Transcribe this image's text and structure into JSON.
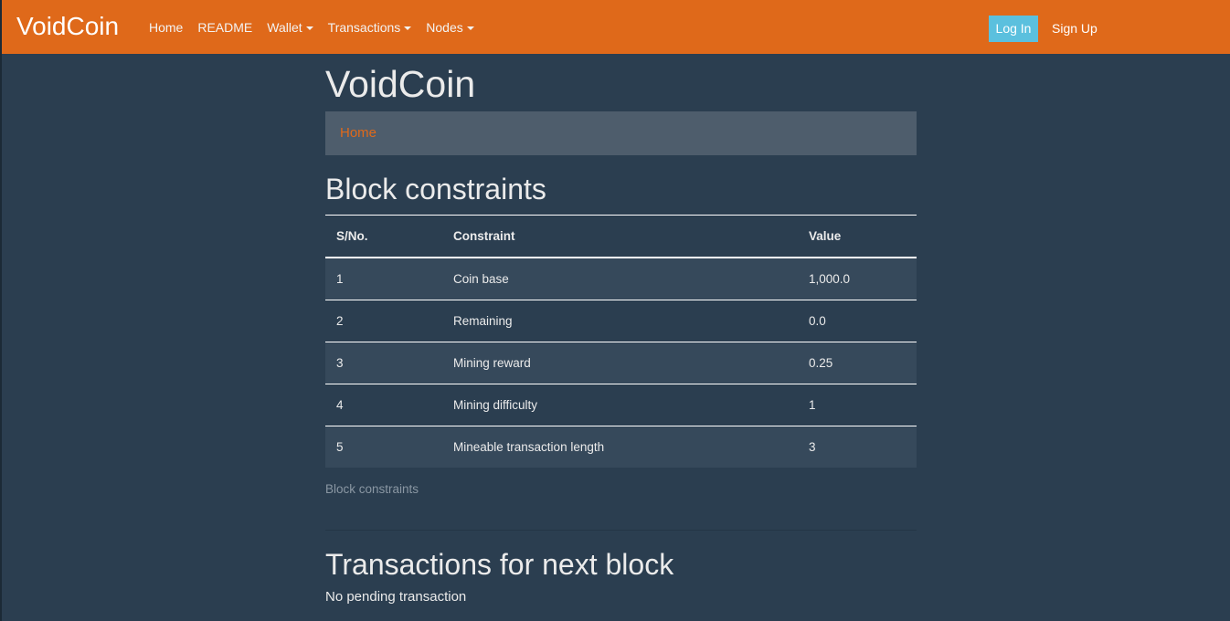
{
  "navbar": {
    "brand": "VoidCoin",
    "links": [
      {
        "label": "Home"
      },
      {
        "label": "README"
      },
      {
        "label": "Wallet"
      },
      {
        "label": "Transactions"
      },
      {
        "label": "Nodes"
      }
    ],
    "login_label": "Log In",
    "signup_label": "Sign Up"
  },
  "page": {
    "title": "VoidCoin",
    "breadcrumb": "Home"
  },
  "block_constraints": {
    "title": "Block constraints",
    "headers": [
      "S/No.",
      "Constraint",
      "Value"
    ],
    "rows": [
      [
        "1",
        "Coin base",
        "1,000.0"
      ],
      [
        "2",
        "Remaining",
        "0.0"
      ],
      [
        "3",
        "Mining reward",
        "0.25"
      ],
      [
        "4",
        "Mining difficulty",
        "1"
      ],
      [
        "5",
        "Mineable transaction length",
        "3"
      ]
    ],
    "caption": "Block constraints"
  },
  "transactions": {
    "title": "Transactions for next block",
    "empty_message": "No pending transaction"
  },
  "colors": {
    "navbar": "#df691a",
    "background": "#2b3e50",
    "breadcrumb_bg": "#4e5d6c",
    "login_button": "#5bc0de",
    "link": "#df691a"
  }
}
